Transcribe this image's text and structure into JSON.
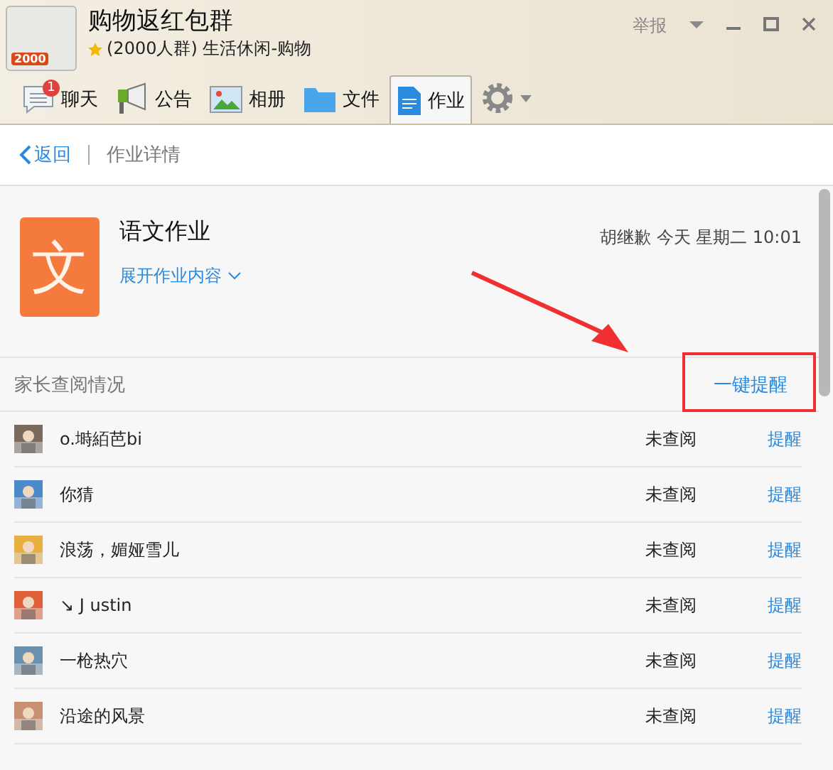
{
  "window": {
    "title": "购物返红包群",
    "subtitle": "(2000人群) 生活休闲-购物",
    "report": "举报",
    "avatar_badge": "2000"
  },
  "tabs": [
    {
      "label": "聊天",
      "badge": "1",
      "selected": false
    },
    {
      "label": "公告",
      "selected": false
    },
    {
      "label": "相册",
      "selected": false
    },
    {
      "label": "文件",
      "selected": false
    },
    {
      "label": "作业",
      "selected": true
    }
  ],
  "nav": {
    "back": "返回",
    "title": "作业详情"
  },
  "homework": {
    "icon_char": "文",
    "title": "语文作业",
    "meta": "胡继歉 今天 星期二 10:01",
    "expand": "展开作业内容"
  },
  "section": {
    "title": "家长查阅情况",
    "remind_all": "一键提醒"
  },
  "rows": [
    {
      "name": "o.塒絔芭bi",
      "status": "未查阅",
      "action": "提醒",
      "color": "#7a6a5a"
    },
    {
      "name": "你猜",
      "status": "未查阅",
      "action": "提醒",
      "color": "#4a8ac8"
    },
    {
      "name": "浪荡，媚娅雪儿",
      "status": "未查阅",
      "action": "提醒",
      "color": "#e8b040"
    },
    {
      "name": "↘  J ustin",
      "status": "未查阅",
      "action": "提醒",
      "color": "#e0603a"
    },
    {
      "name": "一枪热穴",
      "status": "未查阅",
      "action": "提醒",
      "color": "#6a90b0"
    },
    {
      "name": "沿途的风景",
      "status": "未查阅",
      "action": "提醒",
      "color": "#c89070"
    }
  ]
}
